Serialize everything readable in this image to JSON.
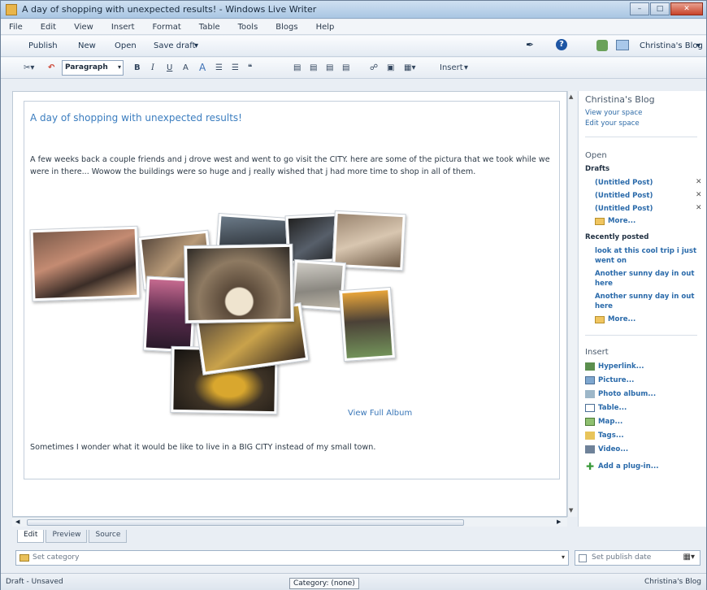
{
  "window": {
    "title": "A day of shopping with unexpected results! - Windows Live Writer"
  },
  "menu": [
    "File",
    "Edit",
    "View",
    "Insert",
    "Format",
    "Table",
    "Tools",
    "Blogs",
    "Help"
  ],
  "toolbar": {
    "publish": "Publish",
    "new": "New",
    "open": "Open",
    "save_draft": "Save draft",
    "blog_name": "Christina's Blog"
  },
  "format_toolbar": {
    "style": "Paragraph",
    "insert": "Insert"
  },
  "post": {
    "title": "A day of shopping with unexpected results!",
    "body": "A few weeks back a couple friends and j drove west and went to go visit the CITY.  here are some of the pictura that we took while we were in there... Wowow the buildings were so huge and j really wished that j had more time to shop in all of them.",
    "album_link": "View Full Album",
    "footer": "Sometimes I wonder what it would be like to live in a BIG CITY instead of my small town."
  },
  "tabs": [
    "Edit",
    "Preview",
    "Source"
  ],
  "category_placeholder": "Set category",
  "publish_date": "Set publish date",
  "status": {
    "left": "Draft - Unsaved",
    "right": "Christina's Blog",
    "tooltip": "Category: (none)"
  },
  "sidebar": {
    "blog_title": "Christina's Blog",
    "view_space": "View your space",
    "edit_space": "Edit your space",
    "open_heading": "Open",
    "drafts_label": "Drafts",
    "drafts": [
      "(Untitled Post)",
      "(Untitled Post)",
      "(Untitled Post)"
    ],
    "more": "More...",
    "recent_label": "Recently posted",
    "recent": [
      "look at this cool trip i just went on",
      "Another sunny day in out here",
      "Another sunny day in out here"
    ],
    "insert_heading": "Insert",
    "insert_items": [
      "Hyperlink...",
      "Picture...",
      "Photo album...",
      "Table...",
      "Map...",
      "Tags...",
      "Video...",
      "Add a plug-in..."
    ]
  }
}
